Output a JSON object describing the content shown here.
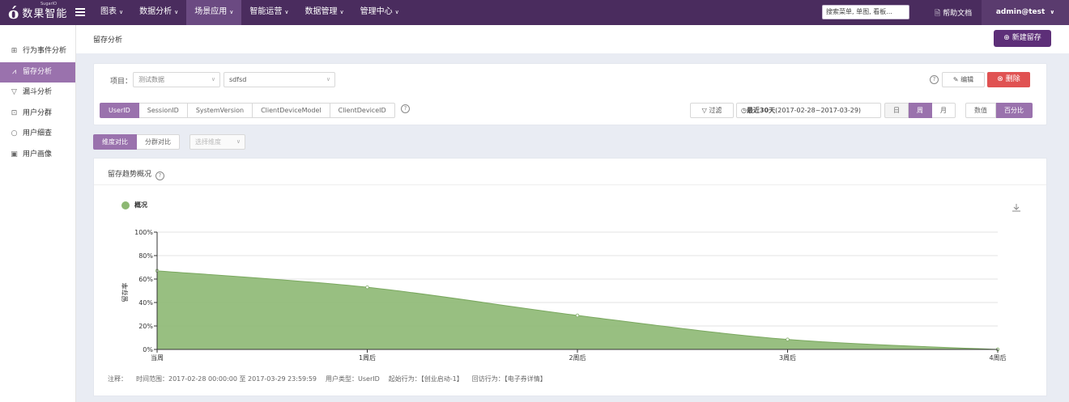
{
  "topbar": {
    "logo_mark": "ó",
    "logo_text": "数果智能",
    "logo_sup": "SugarIO",
    "nav": [
      {
        "label": "图表",
        "active": false
      },
      {
        "label": "数据分析",
        "active": false
      },
      {
        "label": "场景应用",
        "active": true
      },
      {
        "label": "智能运营",
        "active": false
      },
      {
        "label": "数据管理",
        "active": false
      },
      {
        "label": "管理中心",
        "active": false
      }
    ],
    "search_placeholder": "搜索菜单, 单图, 看板...",
    "help_label": "帮助文档",
    "user_label": "admin@test"
  },
  "sidebar": {
    "items": [
      {
        "label": "行为事件分析",
        "icon": "chart-icon",
        "active": false
      },
      {
        "label": "留存分析",
        "icon": "line-chart-icon",
        "active": true
      },
      {
        "label": "漏斗分析",
        "icon": "funnel-icon",
        "active": false
      },
      {
        "label": "用户分群",
        "icon": "group-icon",
        "active": false
      },
      {
        "label": "用户细查",
        "icon": "search-icon",
        "active": false
      },
      {
        "label": "用户画像",
        "icon": "profile-icon",
        "active": false
      }
    ]
  },
  "header": {
    "title": "留存分析",
    "new_button": "新建留存"
  },
  "filters": {
    "project_label": "项目：",
    "project_value": "测试数据",
    "report_value": "sdfsd",
    "edit_label": "编辑",
    "delete_label": "删除",
    "id_tabs": [
      "UserID",
      "SessionID",
      "SystemVersion",
      "ClientDeviceModel",
      "ClientDeviceID"
    ],
    "id_active": 0,
    "filter_label": "过滤",
    "date_range_bold": "最近30天",
    "date_range": "(2017-02-28~2017-03-29)",
    "period_tabs": [
      "日",
      "周",
      "月"
    ],
    "period_active": 1,
    "mode_tabs": [
      "数值",
      "百分比"
    ],
    "mode_active": 1
  },
  "compare": {
    "tabs": [
      "维度对比",
      "分群对比"
    ],
    "active": 0,
    "dimension_placeholder": "选择维度"
  },
  "chart": {
    "panel_title": "留存趋势概况",
    "notes": [
      "注释：",
      "时间范围：2017-02-28 00:00:00 至 2017-03-29 23:59:59",
      "用户类型：UserID",
      "起始行为：【创业启动-1】",
      "回访行为：【电子券详情】"
    ]
  },
  "chart_data": {
    "type": "area",
    "categories": [
      "当周",
      "1周后",
      "2周后",
      "3周后",
      "4周后"
    ],
    "series": [
      {
        "name": "概况",
        "values": [
          67,
          53,
          29,
          8.5,
          0
        ],
        "color": "#8db873"
      }
    ],
    "ylabel": "留存率",
    "yticks": [
      "0%",
      "20%",
      "40%",
      "60%",
      "80%",
      "100%"
    ],
    "ylim": [
      0,
      100
    ],
    "grid": true,
    "legend": "top-left"
  },
  "colors": {
    "topbar": "#4a2c5e",
    "accent": "#9a72ad",
    "danger": "#e05252",
    "series": "#8db873"
  }
}
